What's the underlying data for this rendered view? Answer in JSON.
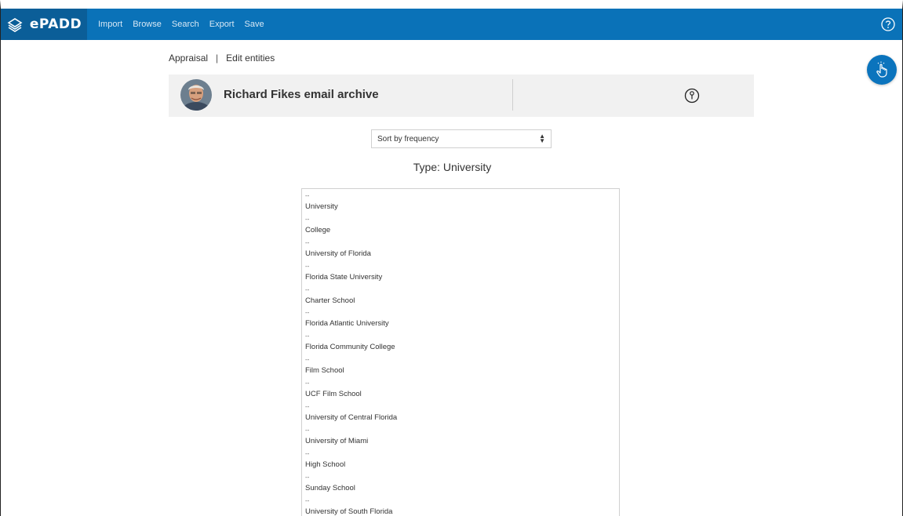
{
  "nav": {
    "brand": "ePADD",
    "items": [
      "Import",
      "Browse",
      "Search",
      "Export",
      "Save"
    ]
  },
  "breadcrumb": {
    "parent": "Appraisal",
    "separator": "|",
    "current": "Edit entities"
  },
  "header": {
    "archive_title": "Richard Fikes email archive"
  },
  "sort": {
    "selected": "Sort by frequency"
  },
  "type_heading": "Type: University",
  "entities": [
    {
      "dash": "--",
      "name": "University"
    },
    {
      "dash": "--",
      "name": "College"
    },
    {
      "dash": "--",
      "name": "University of Florida"
    },
    {
      "dash": "--",
      "name": "Florida State University"
    },
    {
      "dash": "--",
      "name": "Charter School"
    },
    {
      "dash": "--",
      "name": "Florida Atlantic University"
    },
    {
      "dash": "--",
      "name": "Florida Community College"
    },
    {
      "dash": "--",
      "name": "Film School"
    },
    {
      "dash": "--",
      "name": "UCF Film School"
    },
    {
      "dash": "--",
      "name": "University of Central Florida"
    },
    {
      "dash": "--",
      "name": "University of Miami"
    },
    {
      "dash": "--",
      "name": "High School"
    },
    {
      "dash": "--",
      "name": "Sunday School"
    },
    {
      "dash": "--",
      "name": "University of South Florida"
    }
  ],
  "colors": {
    "navbar": "#0a72b8",
    "brand_bg": "#0b5e98",
    "fab": "#0b74bd",
    "header_card": "#f1f1f1"
  },
  "icons": {
    "brand": "epadd-logo-icon",
    "help": "help-circle-icon",
    "fab": "hand-pointer-icon",
    "select": "sort-arrows-icon"
  }
}
